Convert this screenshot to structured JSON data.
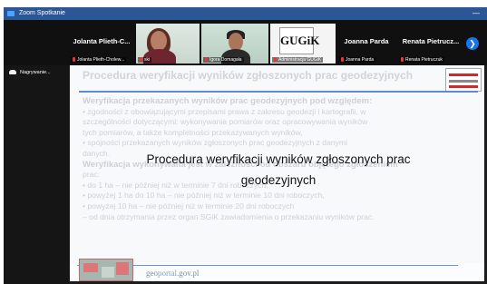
{
  "window": {
    "title": "Zoom Spotkanie",
    "minimize": "—"
  },
  "participants": {
    "p1": {
      "big_name": "Jolanta Plieth-C...",
      "label": "Jolanta Plieth-Cholew..."
    },
    "p2": {
      "label": "ski"
    },
    "p3": {
      "label": "Igora Domagała"
    },
    "p4": {
      "label": "Administracja GUGiK",
      "logo": "GUGiK"
    },
    "p5": {
      "big_name": "Joanna Parda",
      "label": "Joanna Parda"
    },
    "p6": {
      "big_name": "Renata Pietrucz...",
      "label": "Renata Pietruczuk"
    }
  },
  "next_icon": "chevron-right-icon",
  "speaking": {
    "label": "Nagrywanie..."
  },
  "slide": {
    "title": "Procedura weryfikacji wyników zgłoszonych prac geodezyjnych",
    "lines": [
      "Weryfikacja przekazanych wyników prac geodezyjnych pod względem:",
      "• zgodności z obowiązującymi przepisami prawa z zakresu geodezji i kartografii, w",
      "  szczególności dotyczącymi: wykonywania pomiarów oraz opracowywania wyników",
      "  tych pomiarów, a także kompletności przekazywanych wyników,",
      "• spójności przekazanych wyników zgłoszonych prac geodezyjnych z danymi",
      "  danych.",
      "Weryfikacja wykonywana jest w zależności od obszaru objętego zgłoszeniem",
      "prac:",
      "• do 1 ha – nie później niż w terminie 7 dni roboczych,",
      "• powyżej 1 ha do 10 ha – nie później niż w terminie 10 dni roboczych,",
      "• powyżej 10 ha – nie później niż w terminie 20 dni roboczych",
      "– od dnia otrzymania przez organ SGiK zawiadomienia o przekazaniu wyników prac."
    ],
    "overlay_line1": "Procedura weryfikacji wyników zgłoszonych prac",
    "overlay_line2": "geodezyjnych",
    "footer_a": "geo",
    "footer_b": "portal",
    "footer_c": ".gov.pl"
  },
  "colors": {
    "accent": "#2b5797",
    "slide_rule": "#5f8bd1",
    "mute": "#e33333"
  }
}
